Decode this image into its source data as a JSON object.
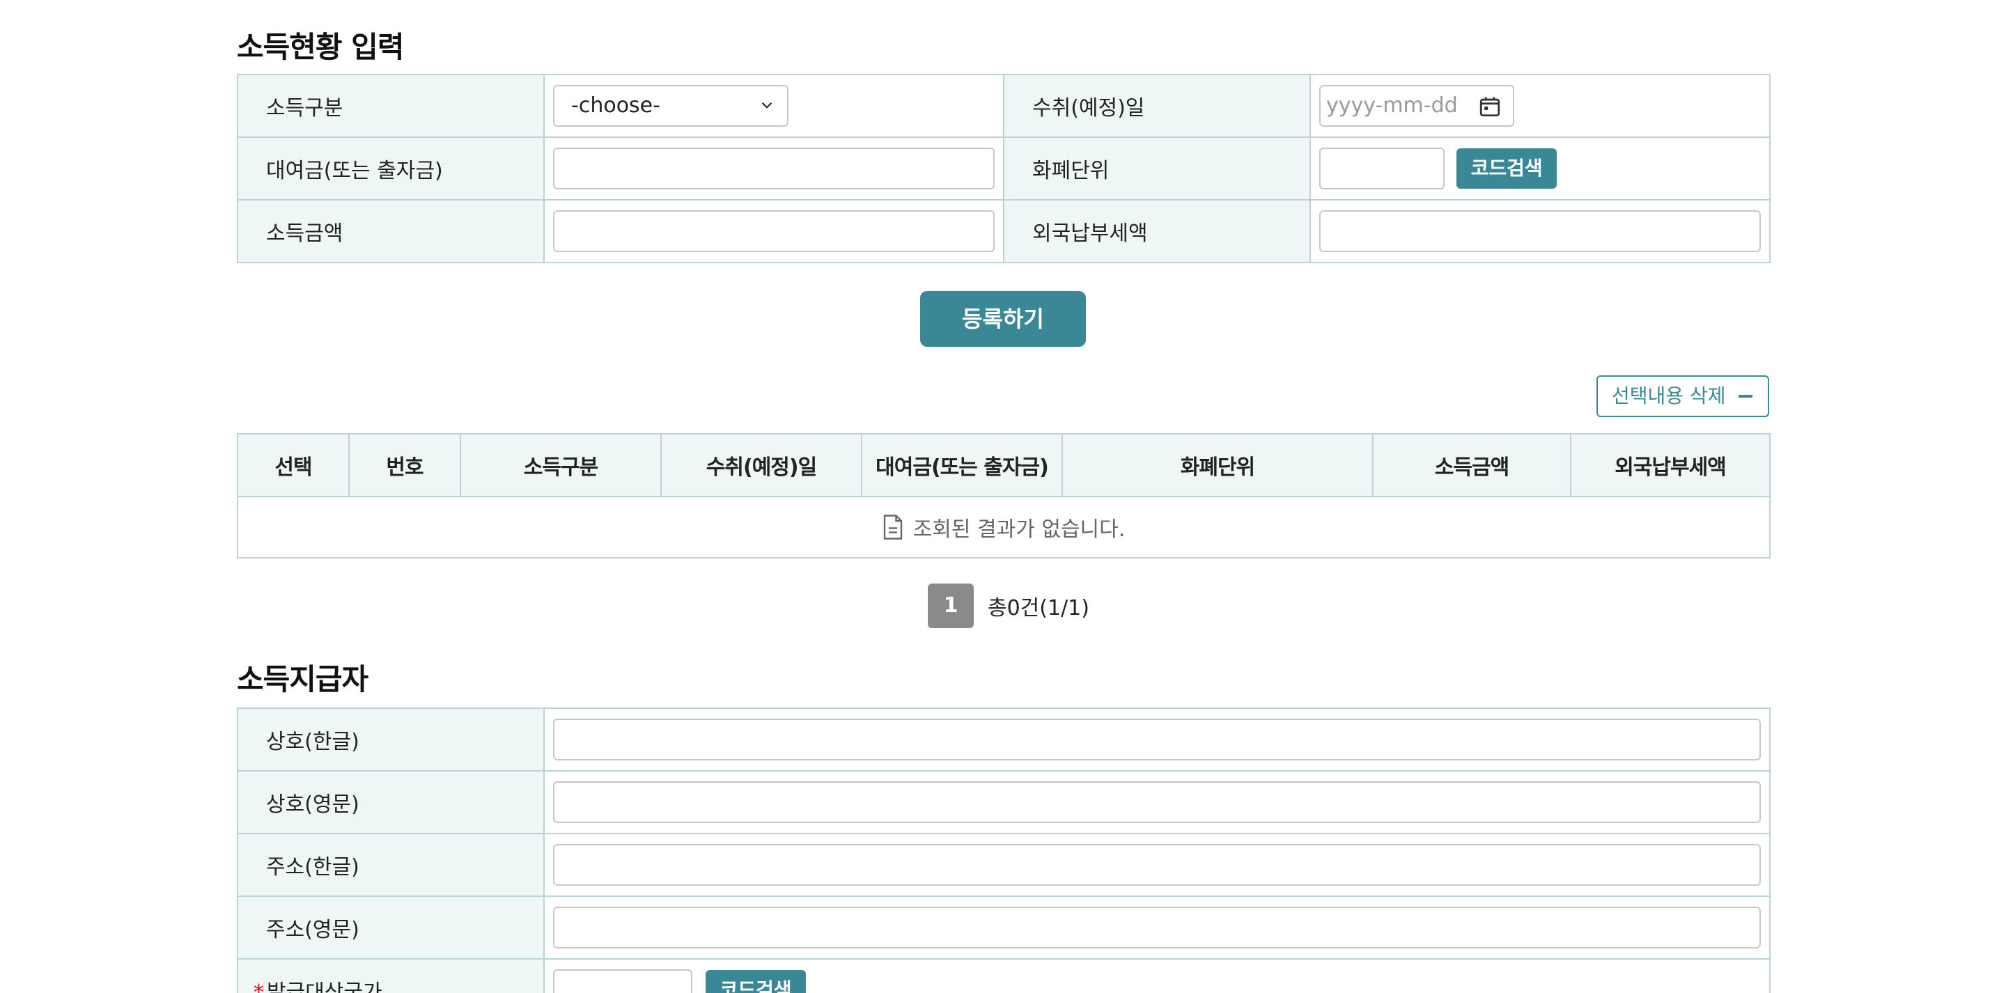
{
  "income_section": {
    "title": "소득현황 입력",
    "rows": [
      {
        "label_left": "소득구분",
        "label_right": "수취(예정)일"
      },
      {
        "label_left": "대여금(또는 출자금)",
        "label_right": "화폐단위"
      },
      {
        "label_left": "소득금액",
        "label_right": "외국납부세액"
      }
    ],
    "income_type_select": {
      "value": "-choose-"
    },
    "receipt_date": {
      "placeholder": "yyyy-mm-dd"
    },
    "loan_amount": {
      "value": ""
    },
    "currency_code": {
      "value": ""
    },
    "income_amount": {
      "value": ""
    },
    "foreign_tax": {
      "value": ""
    },
    "code_search_label": "코드검색",
    "register_label": "등록하기",
    "delete_selected_label": "선택내용 삭제"
  },
  "result_table": {
    "columns": [
      "선택",
      "번호",
      "소득구분",
      "수취(예정)일",
      "대여금(또는 출자금)",
      "화폐단위",
      "소득금액",
      "외국납부세액"
    ],
    "empty_message": "조회된 결과가 없습니다."
  },
  "pagination": {
    "current_page": "1",
    "total_text": "총0건(1/1)"
  },
  "payer_section": {
    "title": "소득지급자",
    "rows": [
      {
        "label": "상호(한글)",
        "value": ""
      },
      {
        "label": "상호(영문)",
        "value": ""
      },
      {
        "label": "주소(한글)",
        "value": ""
      },
      {
        "label": "주소(영문)",
        "value": ""
      }
    ],
    "country_label": "발급대상국가",
    "required_mark": "*",
    "code_search_label": "코드검색"
  },
  "colors": {
    "accent": "#3a8795",
    "label_bg": "#eef6f6",
    "border": "#bcd4d7",
    "page_badge": "#8a8a8a"
  }
}
